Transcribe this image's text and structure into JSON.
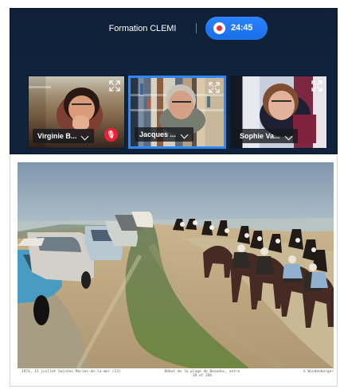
{
  "topbar": {
    "meeting_title": "Formation CLEMI",
    "recording_time": "24:45",
    "record_icon": "record-dot-icon"
  },
  "participants": [
    {
      "name": "Virginie B...",
      "muted": true,
      "muted_icon": "muted-mic-icon",
      "expand_icon": "expand-icon"
    },
    {
      "name": "Jacques ...",
      "active": true,
      "expand_icon": "expand-icon"
    },
    {
      "name": "Sophie Va...",
      "expand_icon": "expand-icon"
    }
  ],
  "shared_content": {
    "caption_left": "1974, 15 juillet    Saintes-Maries-de-la-mer (13)",
    "caption_middle": "Début de la plage de Beauduc, entre 18 et 20h",
    "caption_right": "© Windenberger"
  },
  "colors": {
    "call_background": "#10233d",
    "record_pill": "#176ee9",
    "active_border": "#2c89ff",
    "muted_badge": "#ef1f36"
  }
}
